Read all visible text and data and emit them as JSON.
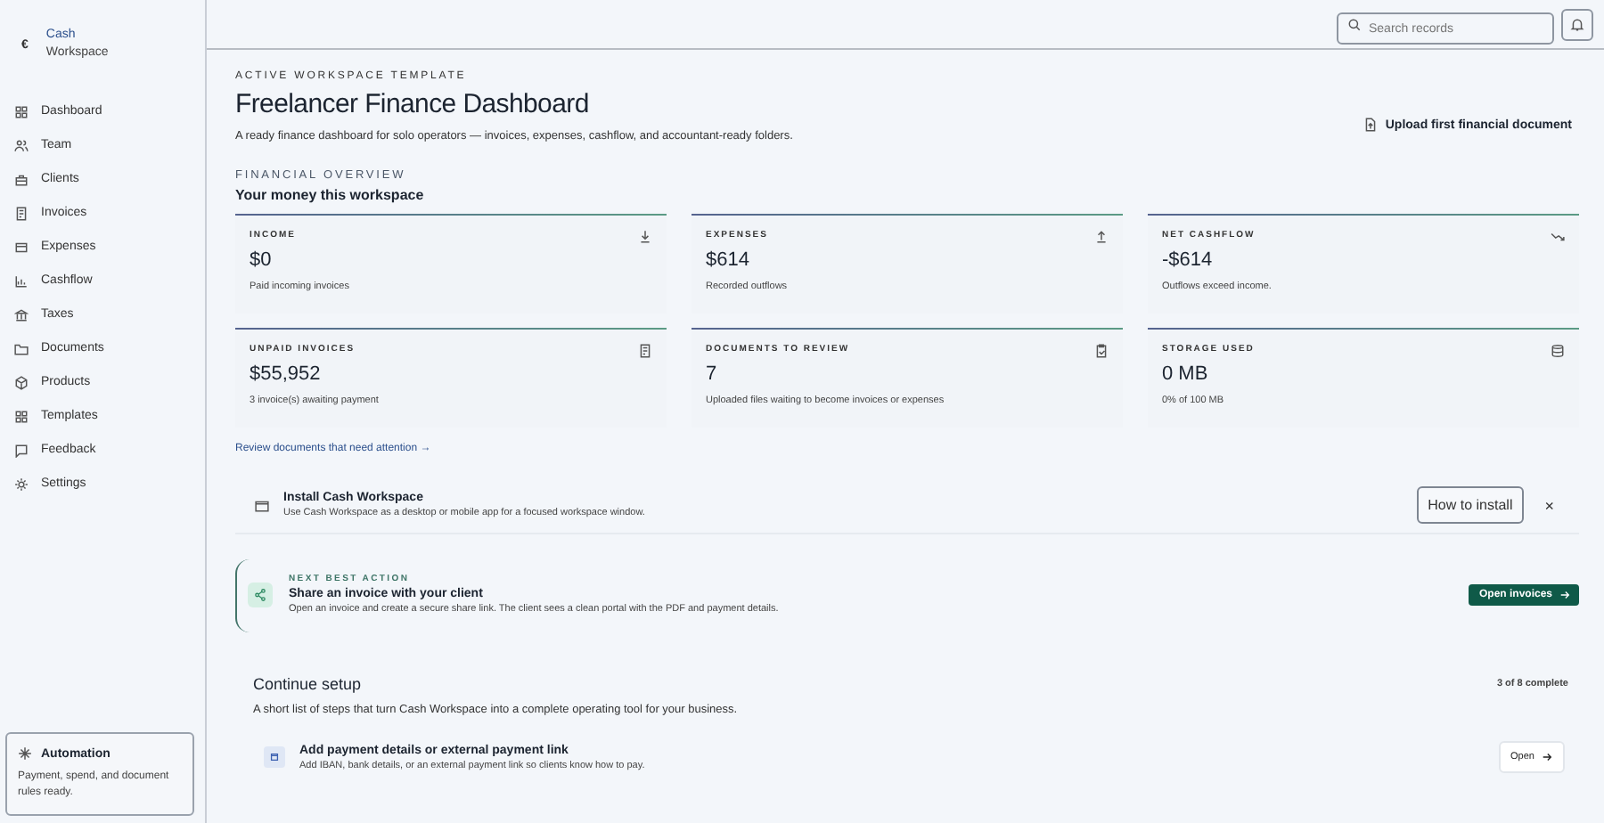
{
  "brand": {
    "line1": "Cash",
    "line2": "Workspace",
    "mark": "€"
  },
  "nav": [
    {
      "label": "Dashboard",
      "selected": false
    },
    {
      "label": "Team",
      "selected": false
    },
    {
      "label": "Clients",
      "selected": false
    },
    {
      "label": "Invoices",
      "selected": false
    },
    {
      "label": "Expenses",
      "selected": false
    },
    {
      "label": "Cashflow",
      "selected": false
    },
    {
      "label": "Taxes",
      "selected": false
    },
    {
      "label": "Documents",
      "selected": false
    },
    {
      "label": "Products",
      "selected": false
    },
    {
      "label": "Templates",
      "selected": false
    },
    {
      "label": "Feedback",
      "selected": false
    },
    {
      "label": "Settings",
      "selected": false
    }
  ],
  "automation": {
    "title": "Automation",
    "text": "Payment, spend, and document rules ready."
  },
  "search": {
    "placeholder": "Search records"
  },
  "header": {
    "eyebrow": "ACTIVE WORKSPACE TEMPLATE",
    "title": "Freelancer Finance Dashboard",
    "description": "A ready finance dashboard for solo operators — invoices, expenses, cashflow, and accountant-ready folders.",
    "upload": "Upload first financial document"
  },
  "overview": {
    "eyebrow": "FINANCIAL OVERVIEW",
    "title": "Your money this workspace"
  },
  "stats": [
    {
      "label": "INCOME",
      "value": "$0",
      "note": "Paid incoming invoices",
      "kind": "download"
    },
    {
      "label": "EXPENSES",
      "value": "$614",
      "note": "Recorded outflows",
      "kind": "upload"
    },
    {
      "label": "NET CASHFLOW",
      "value": "-$614",
      "note": "Outflows exceed income.",
      "kind": "trend"
    },
    {
      "label": "UNPAID INVOICES",
      "value": "$55,952",
      "note": "3 invoice(s) awaiting payment",
      "kind": "receipt"
    },
    {
      "label": "DOCUMENTS TO REVIEW",
      "value": "7",
      "note": "Uploaded files waiting to become invoices or expenses",
      "kind": "clipboard"
    },
    {
      "label": "STORAGE USED",
      "value": "0 MB",
      "note": "0% of 100 MB",
      "kind": "database"
    }
  ],
  "review_link": "Review documents that need attention →",
  "install": {
    "title": "Install Cash Workspace",
    "text": "Use Cash Workspace as a desktop or mobile app for a focused workspace window.",
    "button": "How to install",
    "close": "×"
  },
  "next_action": {
    "eyebrow": "NEXT BEST ACTION",
    "title": "Share an invoice with your client",
    "text": "Open an invoice and create a secure share link. The client sees a clean portal with the PDF and payment details.",
    "button": "Open invoices"
  },
  "setup": {
    "title": "Continue setup",
    "progress": "3 of 8 complete",
    "text": "A short list of steps that turn Cash Workspace into a complete operating tool for your business.",
    "steps": [
      {
        "title": "Add payment details or external payment link",
        "text": "Add IBAN, bank details, or an external payment link so clients know how to pay.",
        "button": "Open"
      }
    ]
  }
}
